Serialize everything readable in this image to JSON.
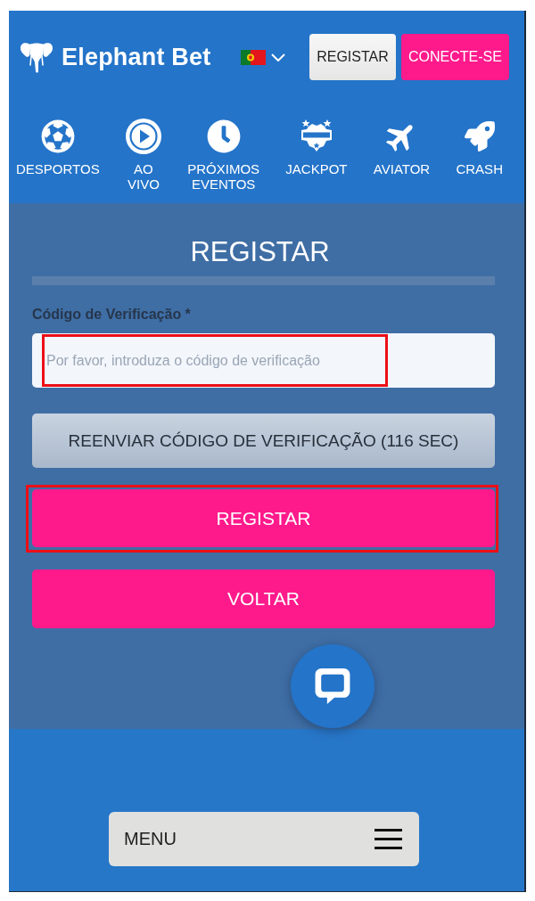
{
  "header": {
    "logo": {
      "text": "Elephant Bet"
    },
    "buttons": [
      {
        "label": "REGISTAR",
        "kind": "register"
      },
      {
        "label": "CONECTE-SE",
        "kind": "login"
      }
    ]
  },
  "nav": [
    {
      "label": "DESPORTOS"
    },
    {
      "label": "AO\nVIVO"
    },
    {
      "label": "PRÓXIMOS\nEVENTOS"
    },
    {
      "label": "JACKPOT"
    },
    {
      "label": "AVIATOR"
    },
    {
      "label": "CRASH"
    }
  ],
  "form": {
    "title": "REGISTAR",
    "field": {
      "label": "Código de Verificação *",
      "placeholder": "Por favor, introduza o código de verificação",
      "highlighted": true
    },
    "buttons": [
      {
        "label": "REENVIAR CÓDIGO DE VERIFICAÇÃO (116 SEC)",
        "kind": "resend",
        "highlighted": false
      },
      {
        "label": "REGISTAR",
        "kind": "submit",
        "highlighted": true
      },
      {
        "label": "VOLTAR",
        "kind": "back",
        "highlighted": false
      }
    ]
  },
  "bottom_bar": {
    "menu": {
      "label": "MENU"
    }
  }
}
